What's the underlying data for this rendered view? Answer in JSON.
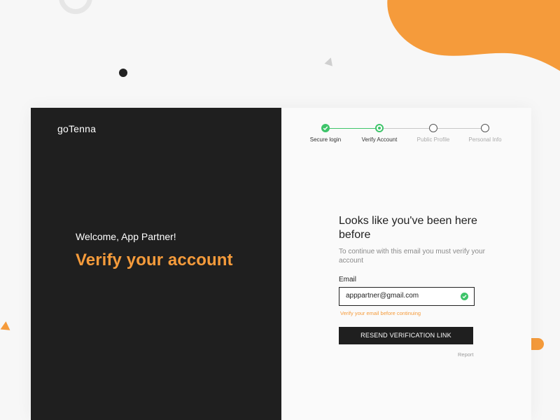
{
  "brand": {
    "logo_text": "goTenna",
    "accent_color": "#f59b3b",
    "success_color": "#3ec46a"
  },
  "hero": {
    "welcome": "Welcome, App Partner!",
    "headline": "Verify your account"
  },
  "stepper": {
    "steps": [
      {
        "label": "Secure login",
        "state": "done"
      },
      {
        "label": "Verify Account",
        "state": "current"
      },
      {
        "label": "Public Profile",
        "state": "todo"
      },
      {
        "label": "Personal Info",
        "state": "todo"
      }
    ]
  },
  "form": {
    "title": "Looks like you've been here before",
    "subtitle": "To continue with this email you must verify your account",
    "email_label": "Email",
    "email_value": "apppartner@gmail.com",
    "email_icon": "check-circle-icon",
    "hint": "Verify your email before continuing",
    "resend_label": "RESEND VERIFICATION LINK",
    "report_label": "Report"
  }
}
